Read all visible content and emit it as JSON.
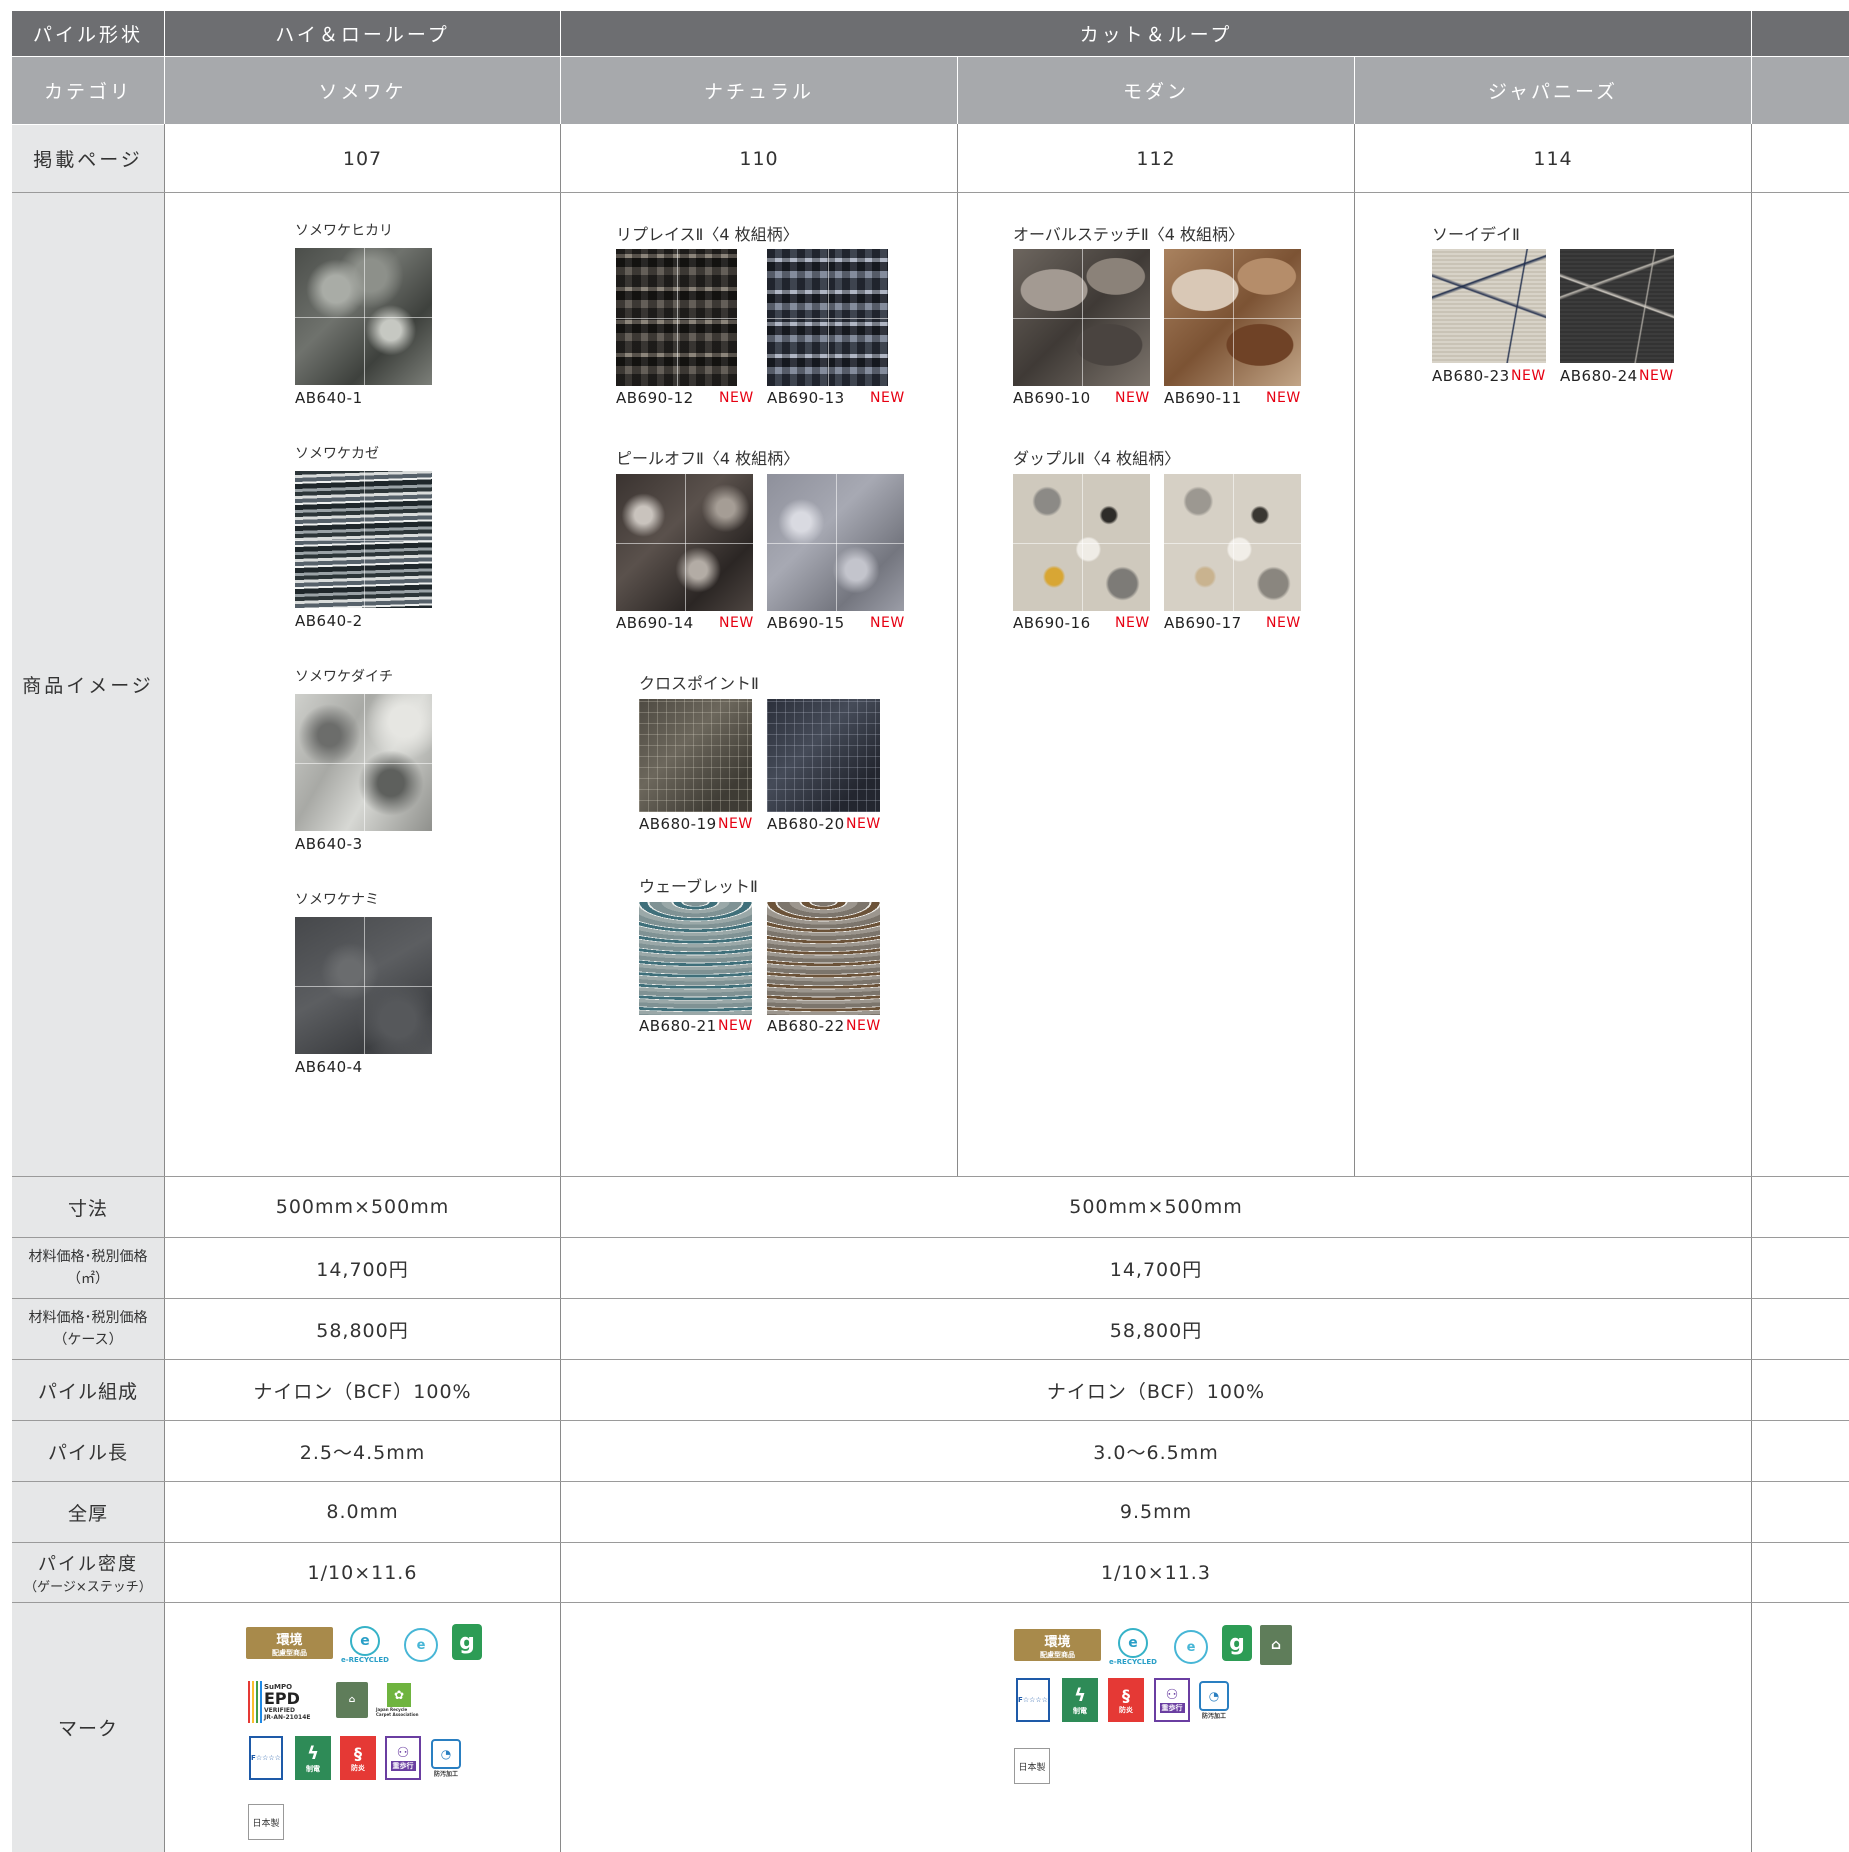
{
  "headers": {
    "pile_shape_label": "パイル形状",
    "pile_shape_hilo": "ハイ＆ローループ",
    "pile_shape_cut": "カット＆ループ",
    "category_label": "カテゴリ",
    "categories": [
      "ソメワケ",
      "ナチュラル",
      "モダン",
      "ジャパニーズ"
    ],
    "page_label": "掲載ページ",
    "pages": [
      "107",
      "110",
      "112",
      "114"
    ]
  },
  "image_label": "商品イメージ",
  "new_badge": "NEW",
  "products": {
    "somewake": {
      "items": [
        {
          "name": "ソメワケヒカリ",
          "code": "AB640-1"
        },
        {
          "name": "ソメワケカゼ",
          "code": "AB640-2"
        },
        {
          "name": "ソメワケダイチ",
          "code": "AB640-3"
        },
        {
          "name": "ソメワケナミ",
          "code": "AB640-4"
        }
      ]
    },
    "natural": {
      "replace": {
        "title": "リプレイスⅡ〈4 枚組柄〉",
        "codes": [
          "AB690-12",
          "AB690-13"
        ]
      },
      "peeloff": {
        "title": "ピールオフⅡ〈4 枚組柄〉",
        "codes": [
          "AB690-14",
          "AB690-15"
        ]
      },
      "crosspoint": {
        "title": "クロスポイントⅡ",
        "codes": [
          "AB680-19",
          "AB680-20"
        ]
      },
      "wavelet": {
        "title": "ウェーブレットⅡ",
        "codes": [
          "AB680-21",
          "AB680-22"
        ]
      }
    },
    "modern": {
      "oval": {
        "title": "オーバルステッチⅡ〈4 枚組柄〉",
        "codes": [
          "AB690-10",
          "AB690-11"
        ]
      },
      "dapple": {
        "title": "ダップルⅡ〈4 枚組柄〉",
        "codes": [
          "AB690-16",
          "AB690-17"
        ]
      }
    },
    "japanese": {
      "soideiy": {
        "title": "ソーイデイⅡ",
        "codes": [
          "AB680-23",
          "AB680-24"
        ]
      }
    }
  },
  "specs": {
    "size_label": "寸法",
    "size": [
      "500mm×500mm",
      "500mm×500mm"
    ],
    "price_sqm_label": "材料価格･税別価格",
    "price_sqm_unit": "（㎡）",
    "price_sqm": [
      "14,700円",
      "14,700円"
    ],
    "price_case_label": "材料価格･税別価格",
    "price_case_unit": "（ケース）",
    "price_case": [
      "58,800円",
      "58,800円"
    ],
    "pile_comp_label": "パイル組成",
    "pile_comp": [
      "ナイロン（BCF）100%",
      "ナイロン（BCF）100%"
    ],
    "pile_len_label": "パイル長",
    "pile_len": [
      "2.5〜4.5mm",
      "3.0〜6.5mm"
    ],
    "thickness_label": "全厚",
    "thickness": [
      "8.0mm",
      "9.5mm"
    ],
    "density_label": "パイル密度",
    "density_sub": "（ゲージ×ステッチ）",
    "density": [
      "1/10×11.6",
      "1/10×11.3"
    ]
  },
  "marks": {
    "label": "マーク",
    "kankyo": "環境",
    "kankyo_sub": "配慮型商品",
    "erecycled": "e-RECYCLED",
    "ecomark": "エコマーク認定品",
    "epd": "EPD",
    "epd_top": "SuMPO",
    "epd_verified": "VERIFIED",
    "epd_id": "JR-AN-21014E",
    "jrca": "Japan Recycle Carpet Association",
    "f4": "F☆☆☆☆",
    "seiden": "制電",
    "bouen": "防炎",
    "hokou": "重歩行",
    "bouo": "防汚加工",
    "made_in_japan": "日本製"
  },
  "colors": {
    "header_dark": "#6d6e71",
    "header_light": "#a7a9ac",
    "label_bg": "#e6e7e8",
    "new_red": "#e60012"
  }
}
